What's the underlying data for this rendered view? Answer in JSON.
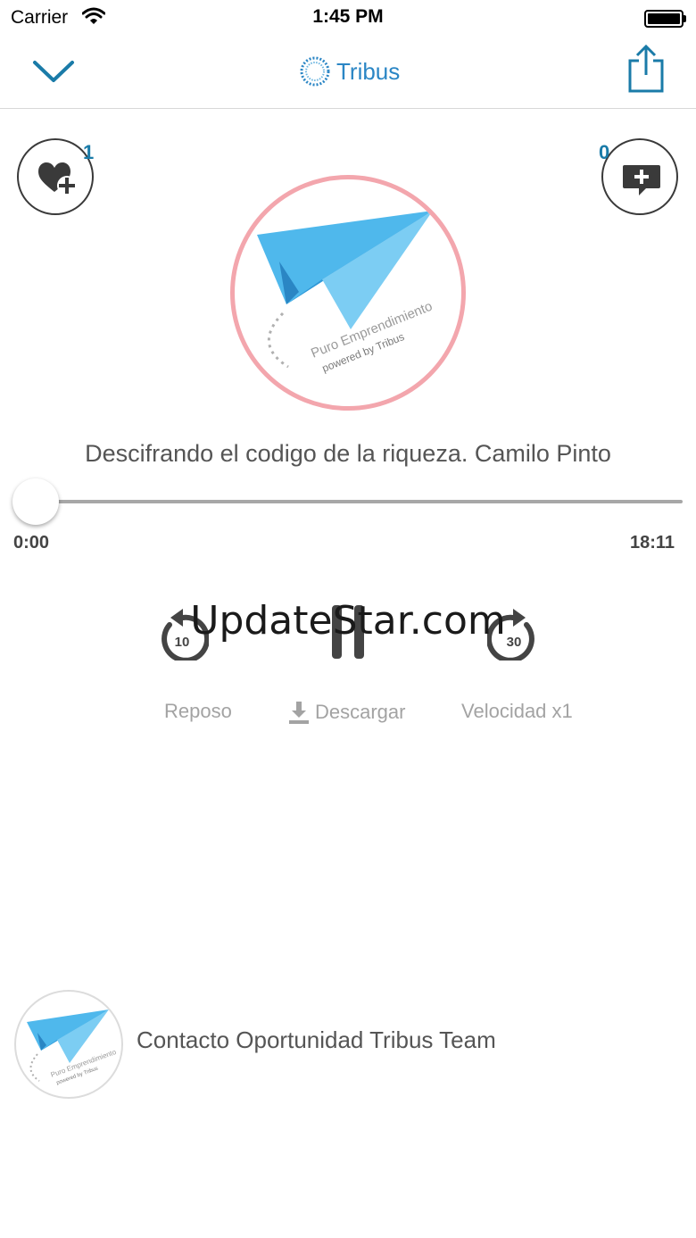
{
  "status_bar": {
    "carrier": "Carrier",
    "time": "1:45 PM",
    "icons": [
      "wifi-icon",
      "battery-icon"
    ]
  },
  "nav": {
    "back_icon": "chevron-down-icon",
    "brand_name": "Tribus",
    "share_icon": "share-icon"
  },
  "actions": {
    "like_count": "1",
    "comment_count": "0",
    "like_icon": "heart-plus-icon",
    "comment_icon": "comment-plus-icon"
  },
  "artwork": {
    "line1": "Puro Emprendimiento",
    "line2": "powered by Tribus"
  },
  "player": {
    "title": "Descifrando el codigo de la riqueza. Camilo Pinto",
    "elapsed": "0:00",
    "total": "18:11",
    "progress": 0,
    "rewind_label": "10",
    "forward_label": "30",
    "watermark": "UpdateStar.com"
  },
  "options": {
    "reposo": "Reposo",
    "descargar": "Descargar",
    "velocidad": "Velocidad x1"
  },
  "contact": {
    "name": "Contacto Oportunidad Tribus Team",
    "line1": "Puro Emprendimiento",
    "line2": "powered by Tribus"
  },
  "colors": {
    "accent": "#1a7ba8",
    "brand": "#2b86c5",
    "artwork_ring": "#f3a6ad",
    "plane": "#4fb8ec"
  }
}
